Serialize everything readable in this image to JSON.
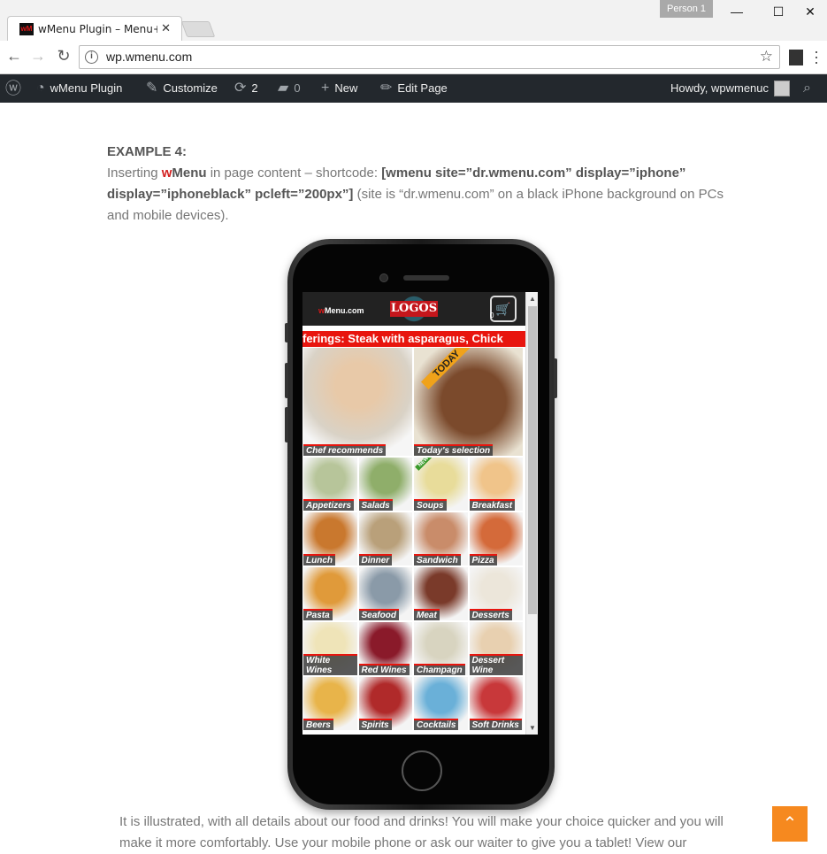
{
  "browser": {
    "tab_title": "wMenu Plugin – Menu+\\",
    "tab_favicon": "wM",
    "profile": "Person 1",
    "url": "wp.wmenu.com"
  },
  "adminbar": {
    "site": "wMenu Plugin",
    "customize": "Customize",
    "updates": "2",
    "comments": "0",
    "new": "New",
    "edit_page": "Edit Page",
    "howdy": "Howdy, wpwmenuc"
  },
  "content": {
    "heading": "EXAMPLE 4:",
    "intro_1": "Inserting ",
    "w": "w",
    "menu": "Menu",
    "intro_2": " in page content – shortcode: ",
    "shortcode": "[wmenu site=”dr.wmenu.com” display=”iphone” display=”iphoneblack” pcleft=”200px”]",
    "intro_3": " (site is “dr.wmenu.com” on a black iPhone background on PCs and mobile devices).",
    "bottom": "It is illustrated, with all details about our food and drinks! You will make your choice quicker and you will make it more comfortably. Use your mobile phone or ask our waiter to give you a tablet! View our"
  },
  "wmenu": {
    "brand_w": "w",
    "brand_rest": "Menu.com",
    "logo_text": "LOGOS",
    "cart_count": "0",
    "ticker": "ferings: Steak with asparagus, Chick",
    "today_badge": "TODAY",
    "new_badge": "NEW",
    "featured": [
      {
        "label": "Chef recommends",
        "color": "#d9d2c6"
      },
      {
        "label": "Today's selection",
        "color": "#7b4a2c"
      }
    ],
    "tiles": [
      {
        "label": "Appetizers",
        "color": "#b7c59a"
      },
      {
        "label": "Salads",
        "color": "#8fae6a"
      },
      {
        "label": "Soups",
        "color": "#e8dc9a"
      },
      {
        "label": "Breakfast",
        "color": "#f0c48a"
      },
      {
        "label": "Lunch",
        "color": "#c9782e"
      },
      {
        "label": "Dinner",
        "color": "#b9a07a"
      },
      {
        "label": "Sandwich",
        "color": "#c98c6a"
      },
      {
        "label": "Pizza",
        "color": "#d46a3a"
      },
      {
        "label": "Pasta",
        "color": "#e09a3a"
      },
      {
        "label": "Seafood",
        "color": "#8a9aa8"
      },
      {
        "label": "Meat",
        "color": "#7a3a2a"
      },
      {
        "label": "Desserts",
        "color": "#ece6da"
      },
      {
        "label": "White Wines",
        "color": "#efe4b8"
      },
      {
        "label": "Red Wines",
        "color": "#8a1a2a"
      },
      {
        "label": "Champagn",
        "color": "#d8d4c0"
      },
      {
        "label": "Dessert Wine",
        "color": "#e8d0b0"
      },
      {
        "label": "Beers",
        "color": "#e8b44a"
      },
      {
        "label": "Spirits",
        "color": "#b02a2a"
      },
      {
        "label": "Cocktails",
        "color": "#6ab0d8"
      },
      {
        "label": "Soft Drinks",
        "color": "#c8383a"
      }
    ]
  }
}
